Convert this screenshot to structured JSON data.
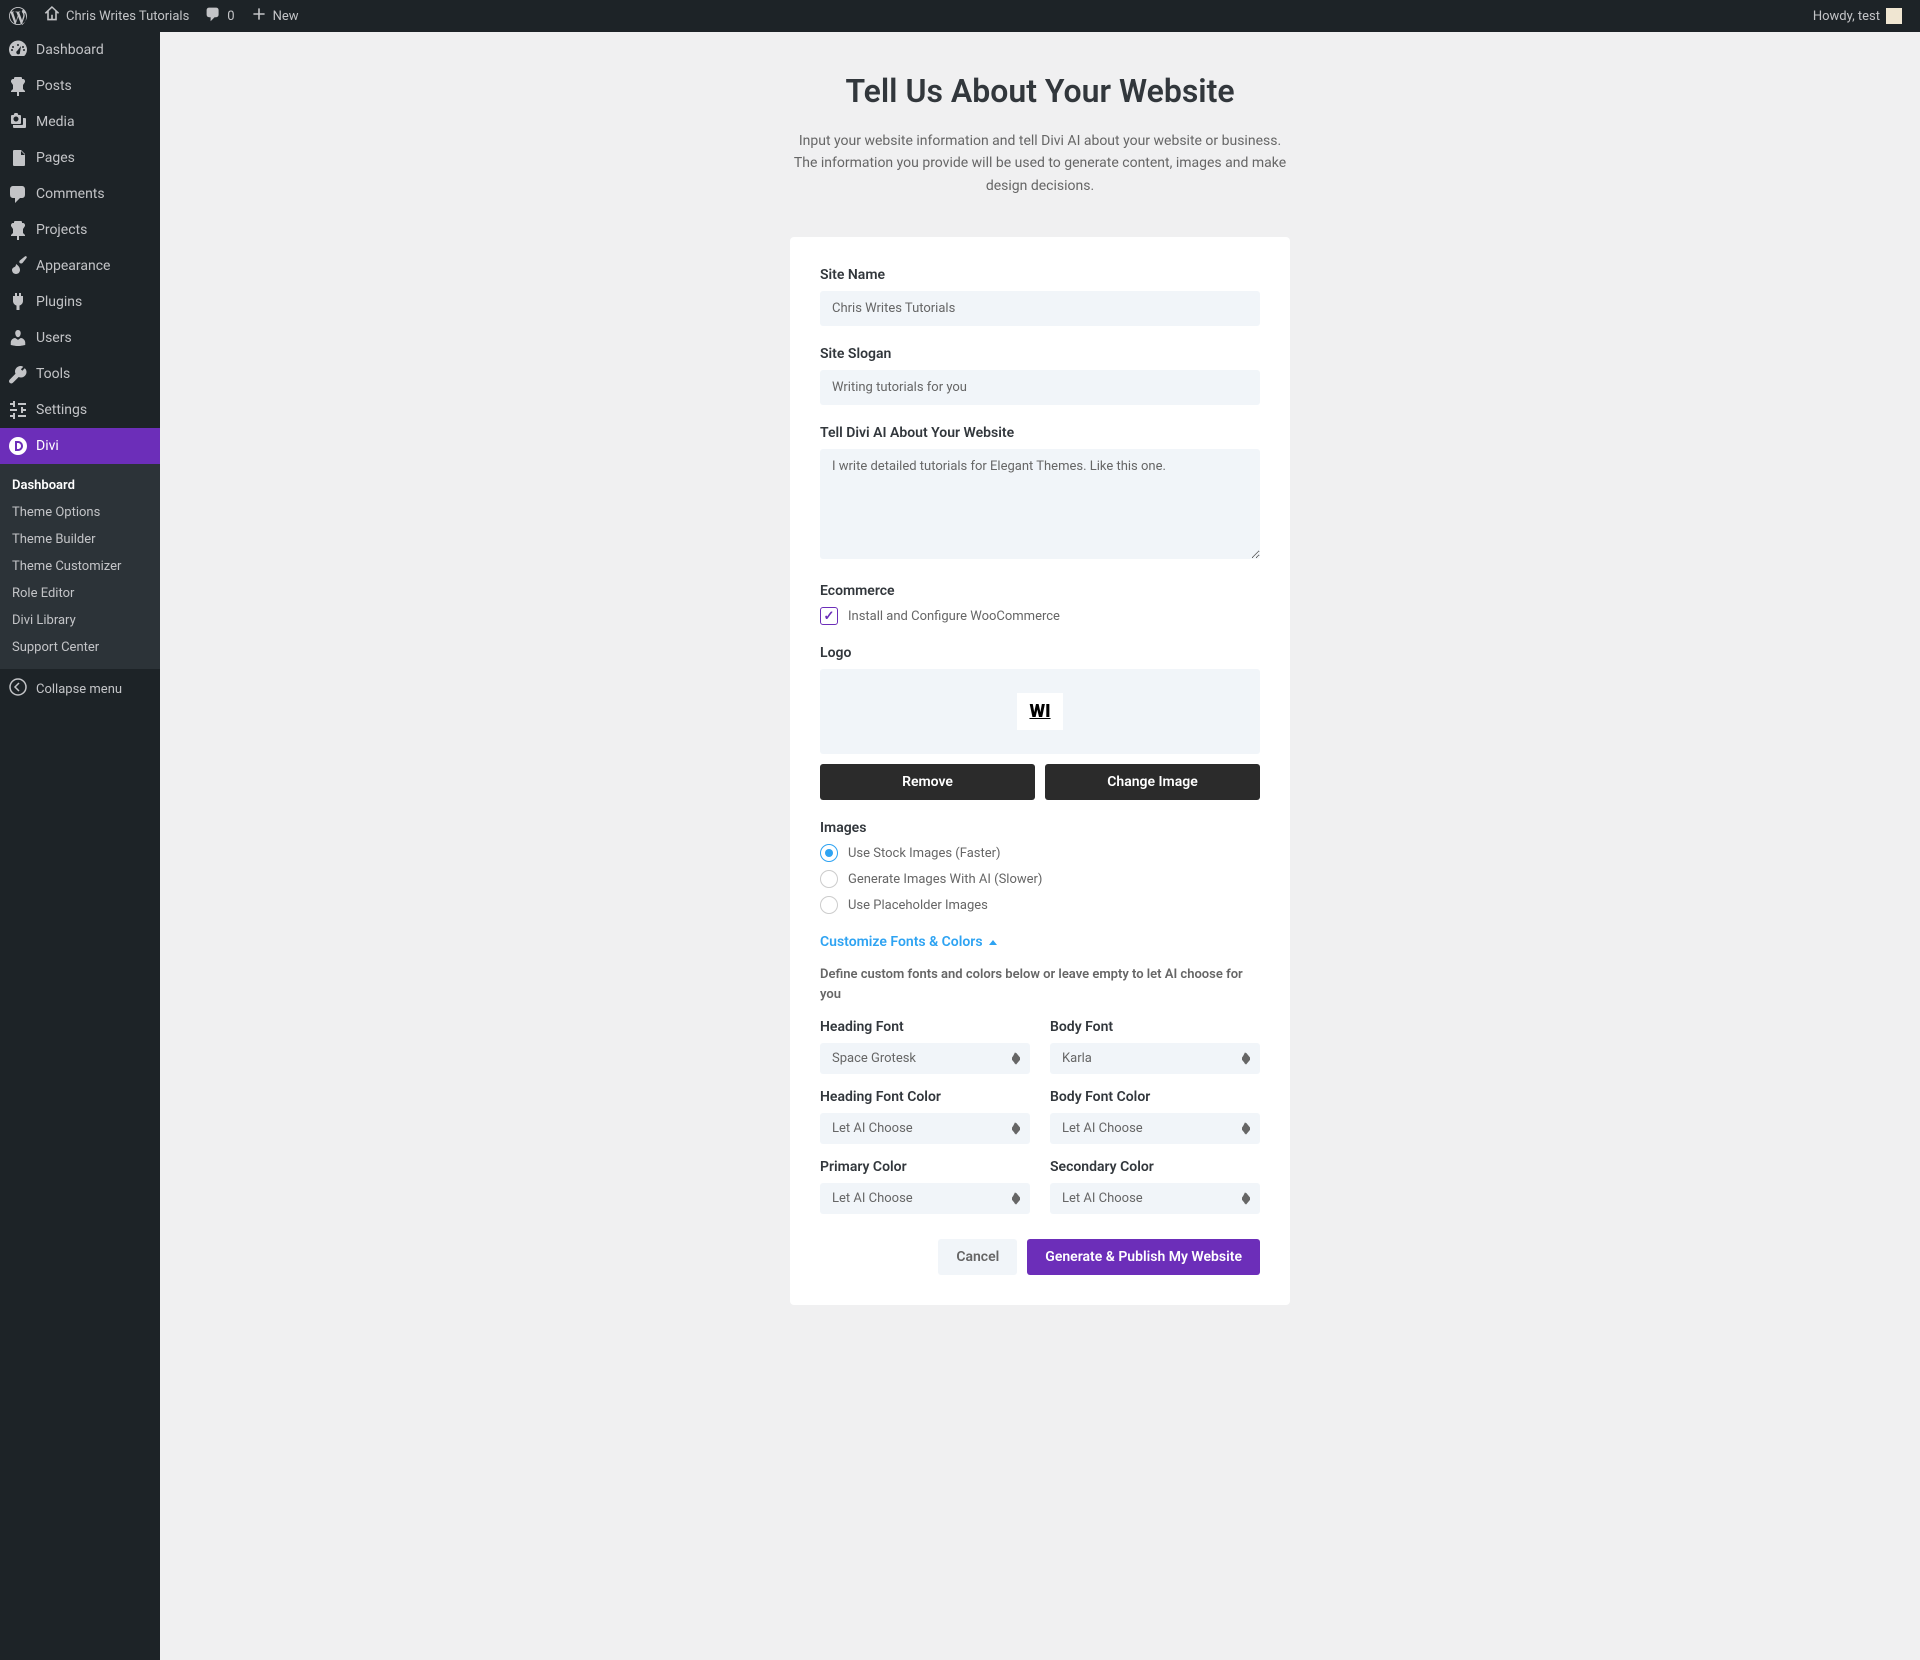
{
  "adminbar": {
    "site_name": "Chris Writes Tutorials",
    "comments_count": "0",
    "new_label": "New",
    "howdy": "Howdy, test"
  },
  "sidebar": {
    "items": [
      {
        "label": "Dashboard"
      },
      {
        "label": "Posts"
      },
      {
        "label": "Media"
      },
      {
        "label": "Pages"
      },
      {
        "label": "Comments"
      },
      {
        "label": "Projects"
      },
      {
        "label": "Appearance"
      },
      {
        "label": "Plugins"
      },
      {
        "label": "Users"
      },
      {
        "label": "Tools"
      },
      {
        "label": "Settings"
      },
      {
        "label": "Divi"
      }
    ],
    "submenu": [
      {
        "label": "Dashboard"
      },
      {
        "label": "Theme Options"
      },
      {
        "label": "Theme Builder"
      },
      {
        "label": "Theme Customizer"
      },
      {
        "label": "Role Editor"
      },
      {
        "label": "Divi Library"
      },
      {
        "label": "Support Center"
      }
    ],
    "collapse_label": "Collapse menu"
  },
  "page": {
    "title": "Tell Us About Your Website",
    "subtitle": "Input your website information and tell Divi AI about your website or business. The information you provide will be used to generate content, images and make design decisions."
  },
  "form": {
    "site_name_label": "Site Name",
    "site_name_value": "Chris Writes Tutorials",
    "slogan_label": "Site Slogan",
    "slogan_value": "Writing tutorials for you",
    "about_label": "Tell Divi AI About Your Website",
    "about_value": "I write detailed tutorials for Elegant Themes. Like this one.",
    "ecommerce_label": "Ecommerce",
    "ecommerce_option": "Install and Configure WooCommerce",
    "logo_label": "Logo",
    "logo_text": "WI",
    "remove_label": "Remove",
    "change_label": "Change Image",
    "images_label": "Images",
    "image_options": [
      "Use Stock Images (Faster)",
      "Generate Images With AI (Slower)",
      "Use Placeholder Images"
    ],
    "customize_link": "Customize Fonts & Colors",
    "customize_helper": "Define custom fonts and colors below or leave empty to let AI choose for you",
    "heading_font_label": "Heading Font",
    "heading_font_value": "Space Grotesk",
    "body_font_label": "Body Font",
    "body_font_value": "Karla",
    "heading_color_label": "Heading Font Color",
    "heading_color_value": "Let AI Choose",
    "body_color_label": "Body Font Color",
    "body_color_value": "Let AI Choose",
    "primary_color_label": "Primary Color",
    "primary_color_value": "Let AI Choose",
    "secondary_color_label": "Secondary Color",
    "secondary_color_value": "Let AI Choose",
    "cancel_label": "Cancel",
    "submit_label": "Generate & Publish My Website"
  }
}
